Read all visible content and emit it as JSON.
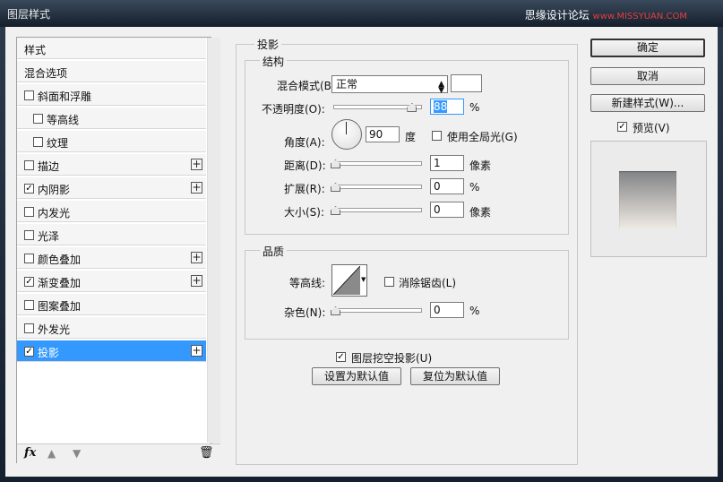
{
  "window": {
    "title": "图层样式",
    "watermark_main": "思缘设计论坛 ",
    "watermark_site": "www.MISSYUAN.COM"
  },
  "styles_list": {
    "items": [
      {
        "label": "样式",
        "checkbox": false,
        "checked": false,
        "plus": false,
        "indent": 0,
        "selected": false
      },
      {
        "label": "混合选项",
        "checkbox": false,
        "checked": false,
        "plus": false,
        "indent": 0,
        "selected": false
      },
      {
        "label": "斜面和浮雕",
        "checkbox": true,
        "checked": false,
        "plus": false,
        "indent": 0,
        "selected": false
      },
      {
        "label": "等高线",
        "checkbox": true,
        "checked": false,
        "plus": false,
        "indent": 1,
        "selected": false
      },
      {
        "label": "纹理",
        "checkbox": true,
        "checked": false,
        "plus": false,
        "indent": 1,
        "selected": false
      },
      {
        "label": "描边",
        "checkbox": true,
        "checked": false,
        "plus": true,
        "indent": 0,
        "selected": false
      },
      {
        "label": "内阴影",
        "checkbox": true,
        "checked": true,
        "plus": true,
        "indent": 0,
        "selected": false
      },
      {
        "label": "内发光",
        "checkbox": true,
        "checked": false,
        "plus": false,
        "indent": 0,
        "selected": false
      },
      {
        "label": "光泽",
        "checkbox": true,
        "checked": false,
        "plus": false,
        "indent": 0,
        "selected": false
      },
      {
        "label": "颜色叠加",
        "checkbox": true,
        "checked": false,
        "plus": true,
        "indent": 0,
        "selected": false
      },
      {
        "label": "渐变叠加",
        "checkbox": true,
        "checked": true,
        "plus": true,
        "indent": 0,
        "selected": false
      },
      {
        "label": "图案叠加",
        "checkbox": true,
        "checked": false,
        "plus": false,
        "indent": 0,
        "selected": false
      },
      {
        "label": "外发光",
        "checkbox": true,
        "checked": false,
        "plus": false,
        "indent": 0,
        "selected": false
      },
      {
        "label": "投影",
        "checkbox": true,
        "checked": true,
        "plus": true,
        "indent": 0,
        "selected": true
      }
    ],
    "fx_label": "fx"
  },
  "drop_shadow": {
    "section_title": "投影",
    "structure": {
      "title": "结构",
      "blend_mode_label": "混合模式(B):",
      "blend_mode_value": "正常",
      "opacity_label": "不透明度(O):",
      "opacity_value": "88",
      "opacity_unit": "%",
      "opacity_level": 0.88,
      "angle_label": "角度(A):",
      "angle_value": "90",
      "angle_unit": "度",
      "global_light_label": "使用全局光(G)",
      "global_light_checked": false,
      "distance_label": "距离(D):",
      "distance_value": "1",
      "distance_unit": "像素",
      "spread_label": "扩展(R):",
      "spread_value": "0",
      "spread_unit": "%",
      "size_label": "大小(S):",
      "size_value": "0",
      "size_unit": "像素",
      "shadow_color": "#ffffff"
    },
    "quality": {
      "title": "品质",
      "contour_label": "等高线:",
      "anti_alias_label": "消除锯齿(L)",
      "anti_alias_checked": false,
      "noise_label": "杂色(N):",
      "noise_value": "0",
      "noise_unit": "%"
    },
    "knockout_label": "图层挖空投影(U)",
    "knockout_checked": true,
    "make_default_label": "设置为默认值",
    "reset_default_label": "复位为默认值"
  },
  "actions": {
    "ok_label": "确定",
    "cancel_label": "取消",
    "new_style_label": "新建样式(W)...",
    "preview_label": "预览(V)",
    "preview_checked": true
  },
  "colors": {
    "selection": "#3399ff",
    "preview_gradient_top": "#838486",
    "preview_gradient_bottom": "#efe9e2"
  }
}
